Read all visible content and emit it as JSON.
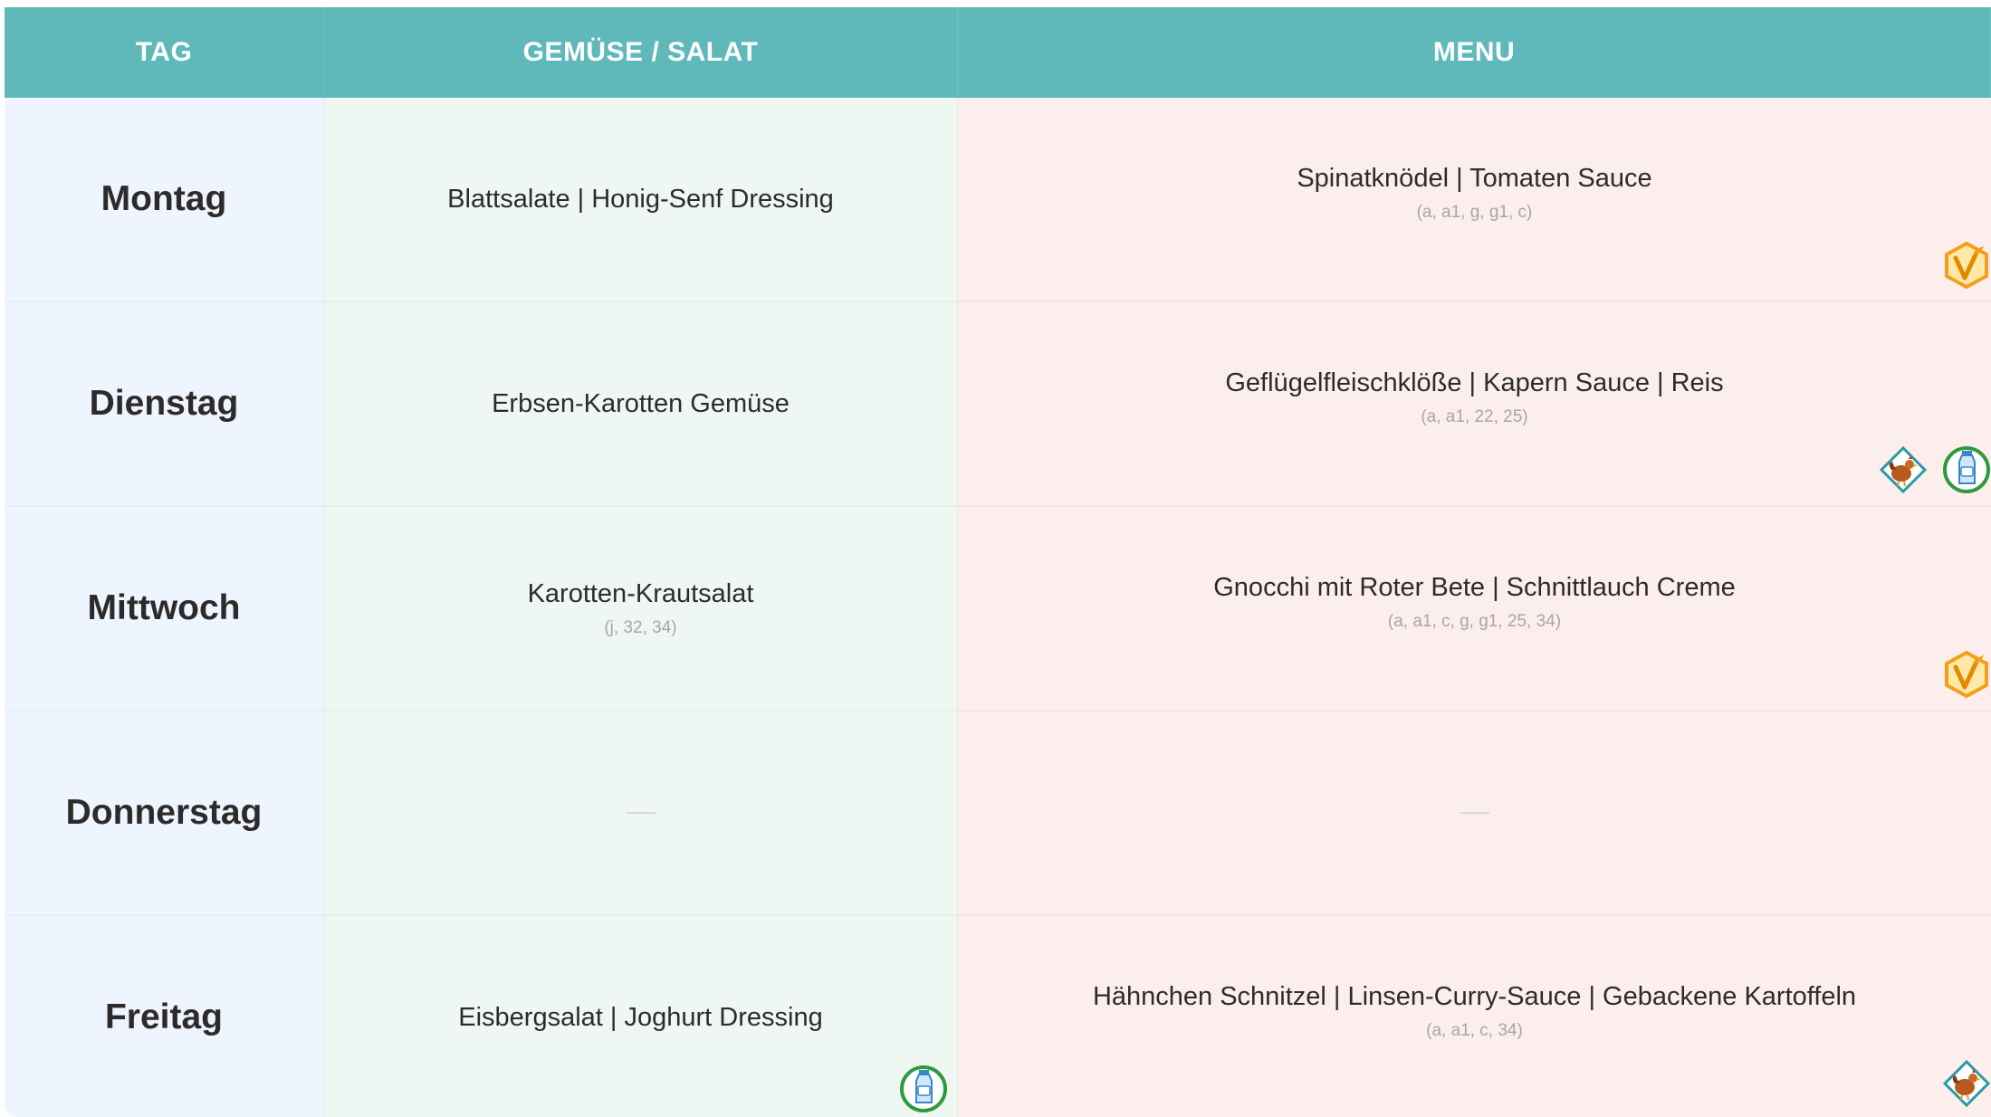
{
  "headers": {
    "day": "TAG",
    "veg": "GEMÜSE / SALAT",
    "menu": "MENU"
  },
  "rows": [
    {
      "day": "Montag",
      "veg": {
        "dish": "Blattsalate | Honig-Senf Dressing",
        "allergens": ""
      },
      "menu": {
        "dish": "Spinatknödel | Tomaten Sauce",
        "allergens": "(a, a1, g, g1, c)"
      },
      "menu_icons": [
        "vegetarian-icon"
      ]
    },
    {
      "day": "Dienstag",
      "veg": {
        "dish": "Erbsen-Karotten Gemüse",
        "allergens": ""
      },
      "menu": {
        "dish": "Geflügelfleischklöße | Kapern Sauce | Reis",
        "allergens": "(a, a1, 22, 25)"
      },
      "menu_icons": [
        "chicken-icon",
        "milk-icon"
      ]
    },
    {
      "day": "Mittwoch",
      "veg": {
        "dish": "Karotten-Krautsalat",
        "allergens": "(j, 32, 34)"
      },
      "menu": {
        "dish": "Gnocchi mit Roter Bete | Schnittlauch Creme",
        "allergens": "(a, a1, c, g, g1, 25, 34)"
      },
      "menu_icons": [
        "vegetarian-icon"
      ]
    },
    {
      "day": "Donnerstag",
      "veg": {
        "dish": "",
        "allergens": ""
      },
      "menu": {
        "dish": "",
        "allergens": ""
      },
      "menu_icons": []
    },
    {
      "day": "Freitag",
      "veg": {
        "dish": "Eisbergsalat | Joghurt Dressing",
        "allergens": ""
      },
      "menu": {
        "dish": "Hähnchen Schnitzel | Linsen-Curry-Sauce | Gebackene Kartoffeln",
        "allergens": "(a, a1, c, 34)"
      },
      "veg_icons": [
        "milk-icon"
      ],
      "menu_icons": [
        "chicken-icon"
      ]
    }
  ],
  "colors": {
    "header": "#5fb9bb",
    "day_column": "#eef5ff",
    "veg_column": "#eef7f2",
    "menu_column": "#fdeeee",
    "vegetarian_badge": "#f2a01b",
    "milk_badge_ring": "#2e9a3e",
    "chicken_badge_ring": "#2a9aa6"
  }
}
